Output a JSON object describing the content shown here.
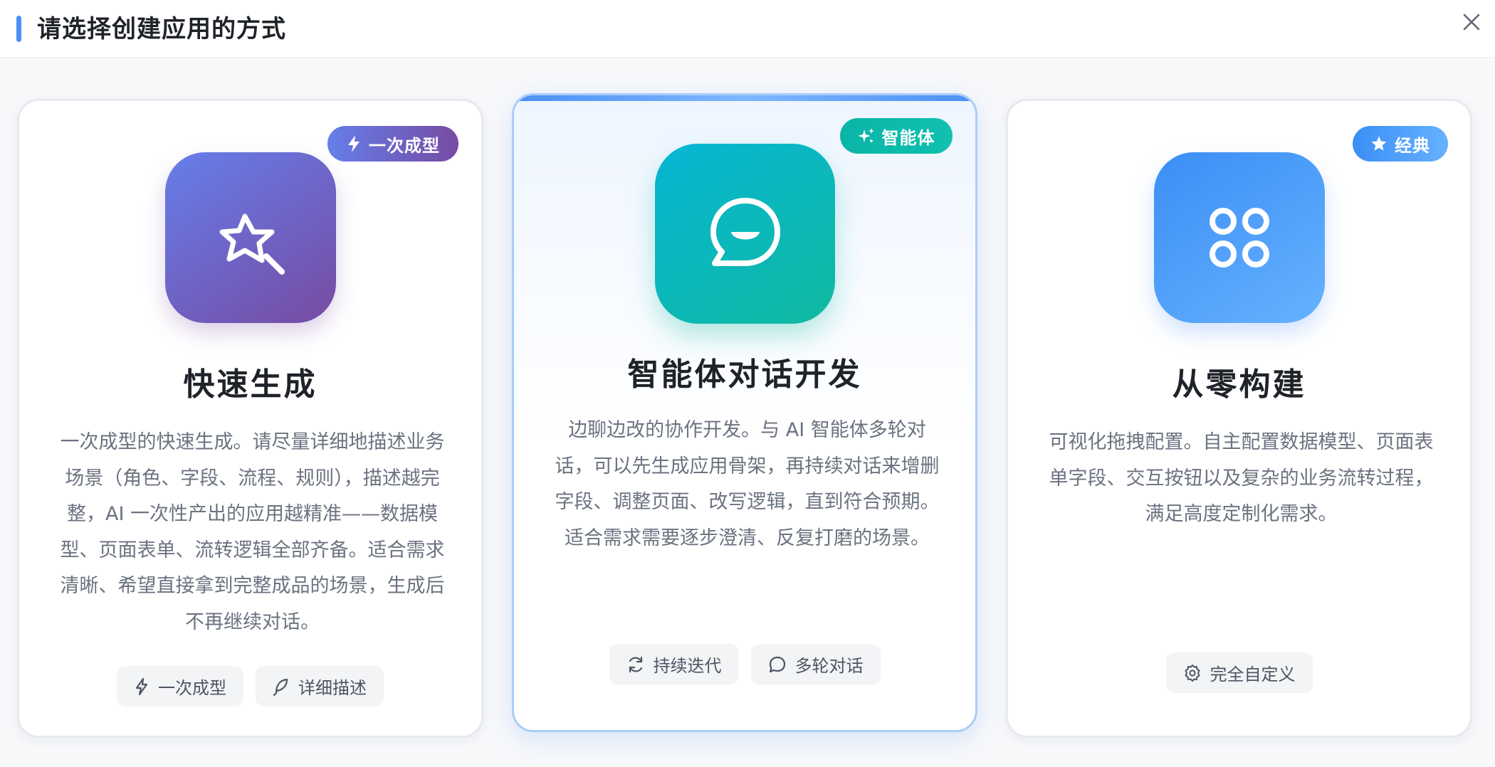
{
  "header": {
    "title": "请选择创建应用的方式"
  },
  "cards": [
    {
      "badge": "一次成型",
      "badge_icon": "lightning-icon",
      "icon": "magic-wand-icon",
      "title": "快速生成",
      "description": "一次成型的快速生成。请尽量详细地描述业务场景（角色、字段、流程、规则），描述越完整，AI 一次性产出的应用越精准——数据模型、页面表单、流转逻辑全部齐备。适合需求清晰、希望直接拿到完整成品的场景，生成后不再继续对话。",
      "tags": [
        {
          "label": "一次成型",
          "icon": "lightning-icon"
        },
        {
          "label": "详细描述",
          "icon": "feather-icon"
        }
      ]
    },
    {
      "badge": "智能体",
      "badge_icon": "sparkle-icon",
      "icon": "chat-smile-icon",
      "title": "智能体对话开发",
      "description": "边聊边改的协作开发。与 AI 智能体多轮对话，可以先生成应用骨架，再持续对话来增删字段、调整页面、改写逻辑，直到符合预期。适合需求需要逐步澄清、反复打磨的场景。",
      "tags": [
        {
          "label": "持续迭代",
          "icon": "refresh-icon"
        },
        {
          "label": "多轮对话",
          "icon": "chat-bubble-icon"
        }
      ]
    },
    {
      "badge": "经典",
      "badge_icon": "star-icon",
      "icon": "four-circles-icon",
      "title": "从零构建",
      "description": "可视化拖拽配置。自主配置数据模型、页面表单字段、交互按钮以及复杂的业务流转过程，满足高度定制化需求。",
      "tags": [
        {
          "label": "完全自定义",
          "icon": "gear-icon"
        }
      ]
    }
  ],
  "colors": {
    "accent": "#4a90f5",
    "purple_gradient": [
      "#667eea",
      "#764ba2"
    ],
    "teal_gradient": [
      "#06b6d4",
      "#10b9a0"
    ],
    "blue_gradient": [
      "#3b8ef5",
      "#66b1ff"
    ]
  }
}
